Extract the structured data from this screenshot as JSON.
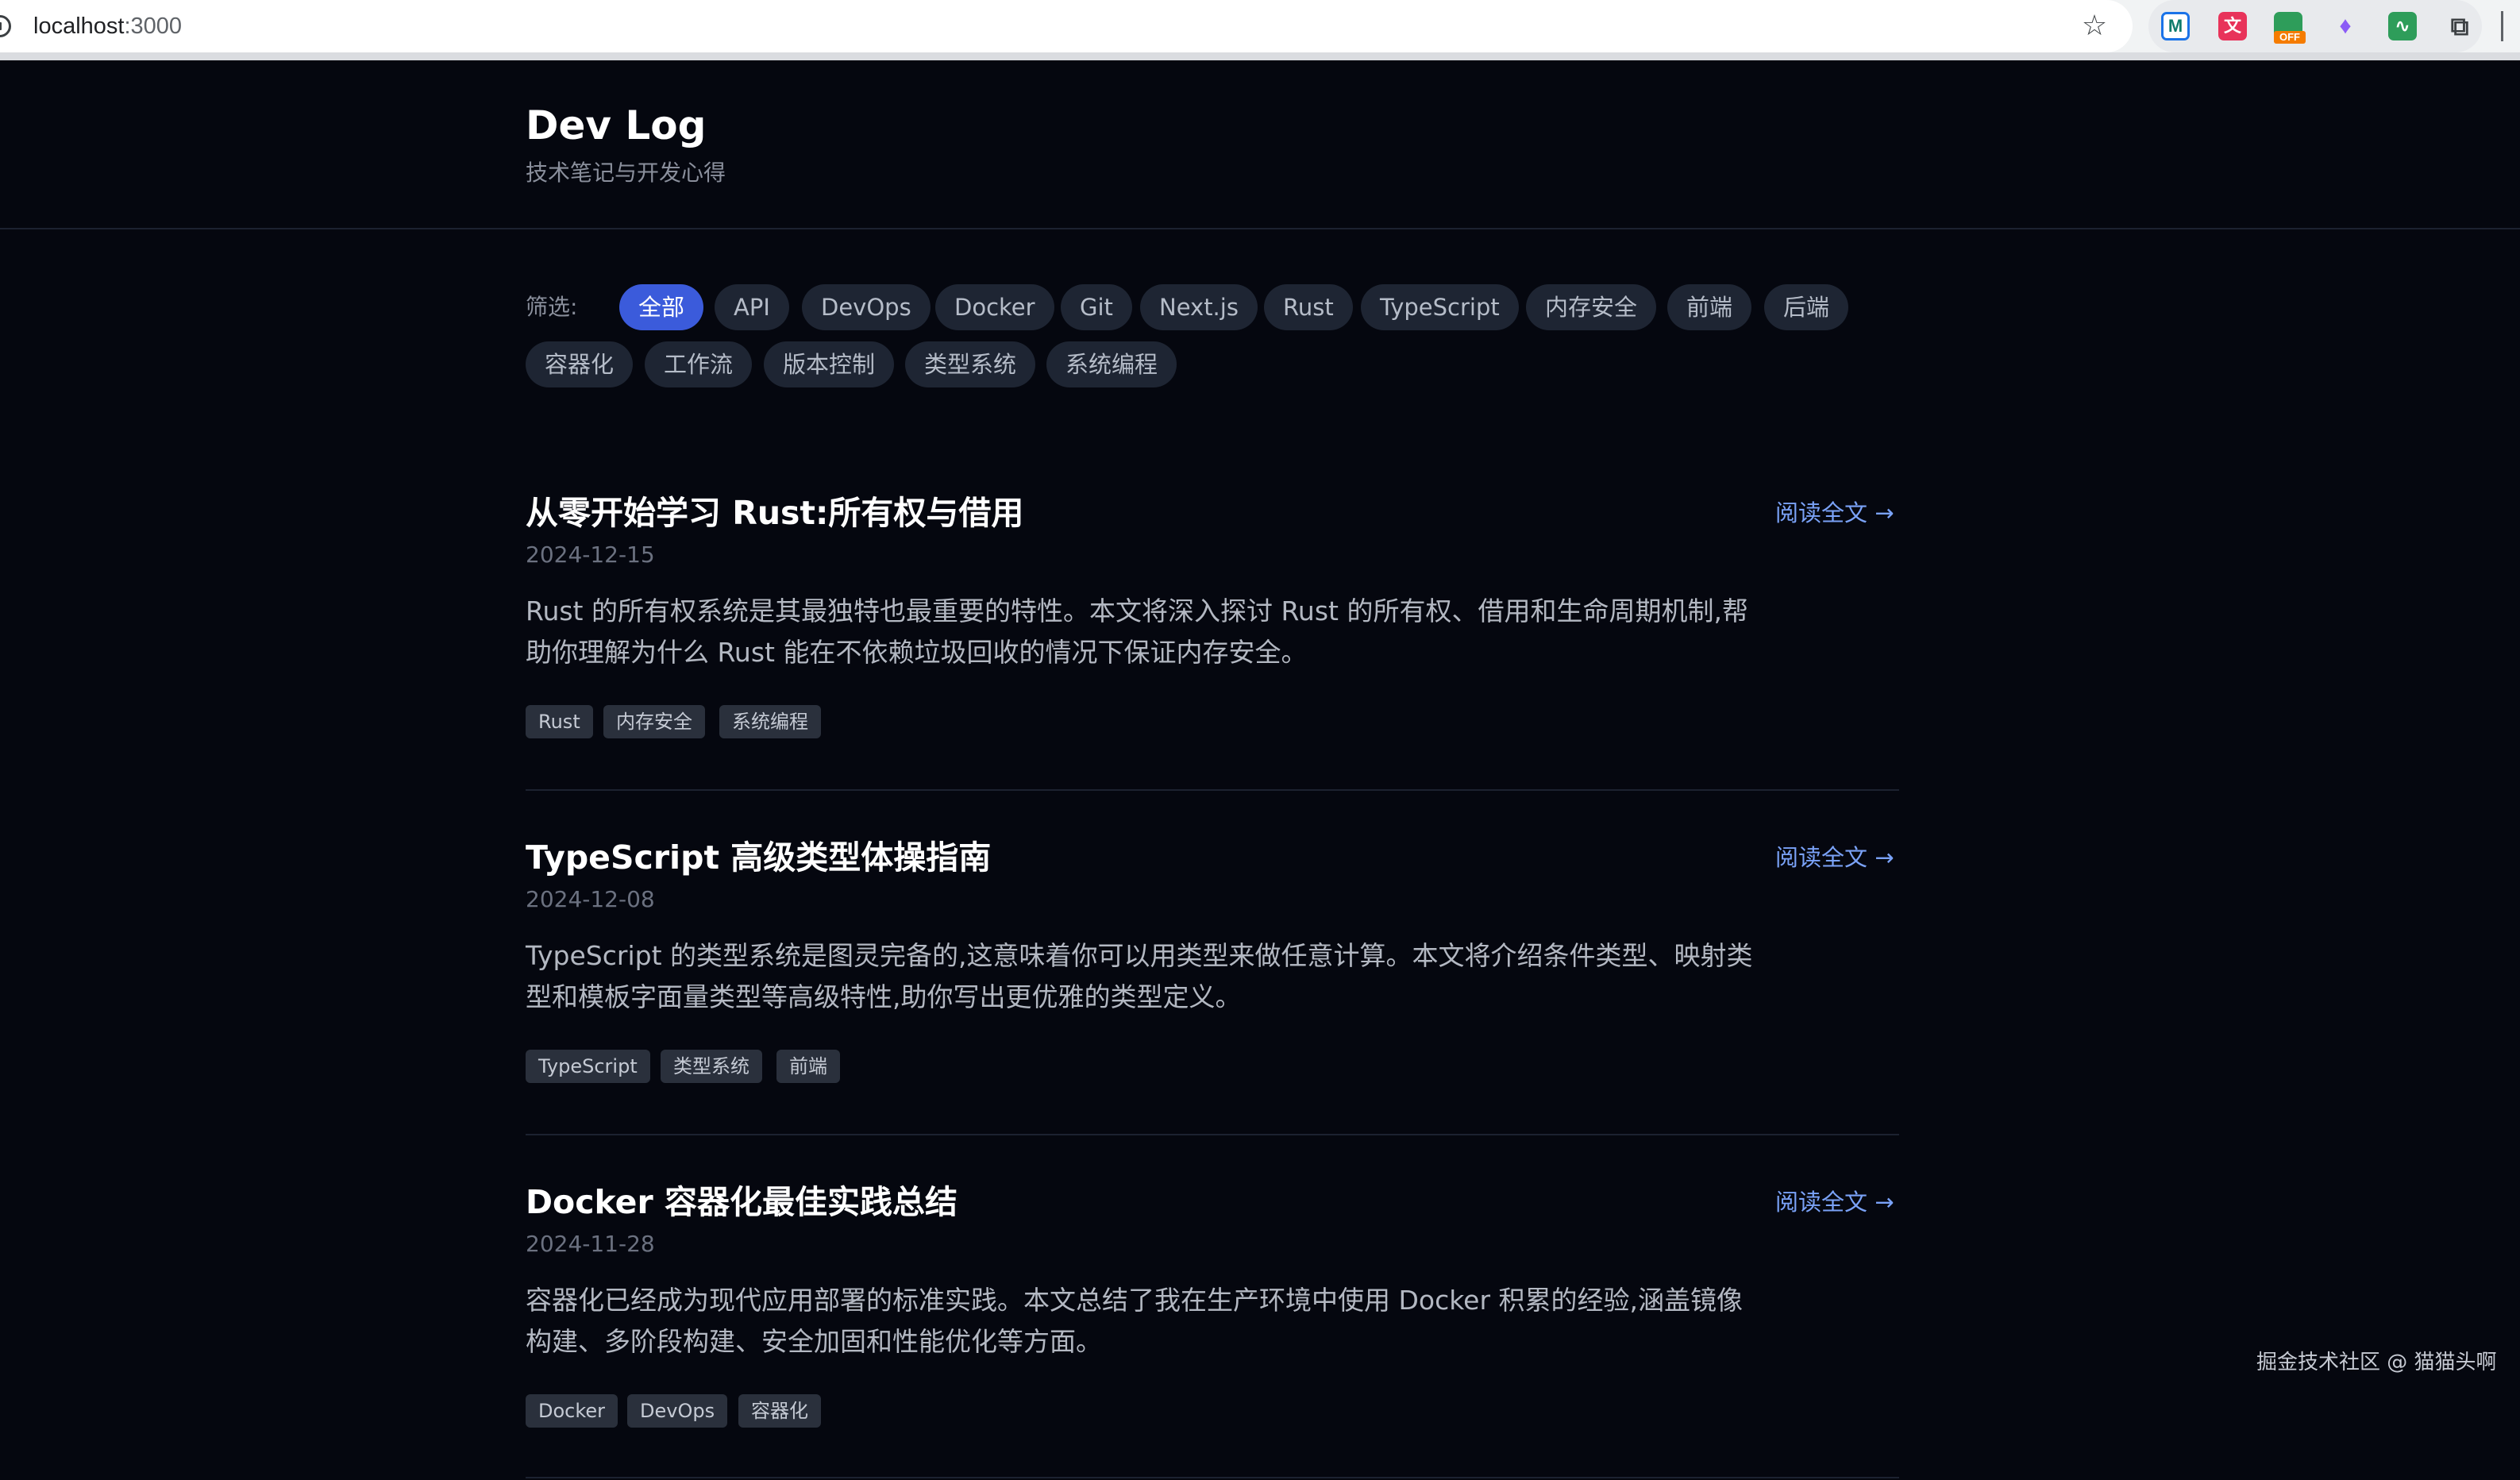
{
  "browser": {
    "url_host": "localhost",
    "url_port": ":3000",
    "extensions": [
      {
        "name": "m-extension-icon",
        "glyph": "M"
      },
      {
        "name": "translate-extension-icon",
        "glyph": "文"
      },
      {
        "name": "off-extension-icon",
        "glyph": "",
        "badge": "OFF"
      },
      {
        "name": "gem-extension-icon",
        "glyph": "♦"
      },
      {
        "name": "pulse-extension-icon",
        "glyph": "∿"
      },
      {
        "name": "puzzle-icon",
        "glyph": "⧉"
      }
    ],
    "bookmark_icon": "☆"
  },
  "header": {
    "title": "Dev Log",
    "subtitle": "技术笔记与开发心得"
  },
  "filter": {
    "label": "筛选:",
    "chips": [
      "全部",
      "API",
      "DevOps",
      "Docker",
      "Git",
      "Next.js",
      "Rust",
      "TypeScript",
      "内存安全",
      "前端",
      "后端",
      "容器化",
      "工作流",
      "版本控制",
      "类型系统",
      "系统编程"
    ],
    "active": "全部"
  },
  "read_more_label": "阅读全文 →",
  "posts": [
    {
      "title": "从零开始学习 Rust:所有权与借用",
      "date": "2024-12-15",
      "excerpt": "Rust 的所有权系统是其最独特也最重要的特性。本文将深入探讨 Rust 的所有权、借用和生命周期机制,帮助你理解为什么 Rust 能在不依赖垃圾回收的情况下保证内存安全。",
      "tags": [
        "Rust",
        "内存安全",
        "系统编程"
      ]
    },
    {
      "title": "TypeScript 高级类型体操指南",
      "date": "2024-12-08",
      "excerpt": "TypeScript 的类型系统是图灵完备的,这意味着你可以用类型来做任意计算。本文将介绍条件类型、映射类型和模板字面量类型等高级特性,助你写出更优雅的类型定义。",
      "tags": [
        "TypeScript",
        "类型系统",
        "前端"
      ]
    },
    {
      "title": "Docker 容器化最佳实践总结",
      "date": "2024-11-28",
      "excerpt": "容器化已经成为现代应用部署的标准实践。本文总结了我在生产环境中使用 Docker 积累的经验,涵盖镜像构建、多阶段构建、安全加固和性能优化等方面。",
      "tags": [
        "Docker",
        "DevOps",
        "容器化"
      ]
    }
  ],
  "footer": {
    "credit": "掘金技术社区 @ 猫猫头啊"
  }
}
